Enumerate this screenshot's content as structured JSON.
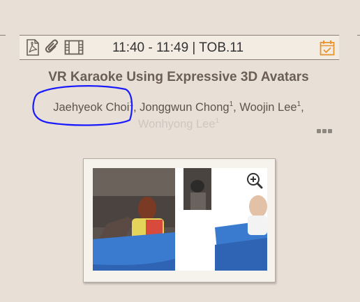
{
  "session": {
    "time": "11:40 - 11:49 | TOB.11",
    "icons": [
      "pdf-icon",
      "attachment-icon",
      "video-icon",
      "calendar-check-icon"
    ]
  },
  "paper": {
    "title": "VR Karaoke Using Expressive 3D Avatars",
    "authors": [
      {
        "name": "Jaehyeok Choi",
        "affil": "1"
      },
      {
        "name": "Jonggwun Chong",
        "affil": "1"
      },
      {
        "name": "Woojin Lee",
        "affil": "1"
      },
      {
        "name": "Wonhyong Lee",
        "affil": "1"
      }
    ],
    "separator": ", "
  },
  "more_menu": {
    "icon": "more-dots-icon"
  },
  "thumbnail": {
    "zoom_icon": "zoom-in-icon"
  },
  "colors": {
    "background": "#e8e0d7",
    "bar": "#f3ece3",
    "accent": "#e8942e",
    "annotation": "#1a1aff"
  }
}
